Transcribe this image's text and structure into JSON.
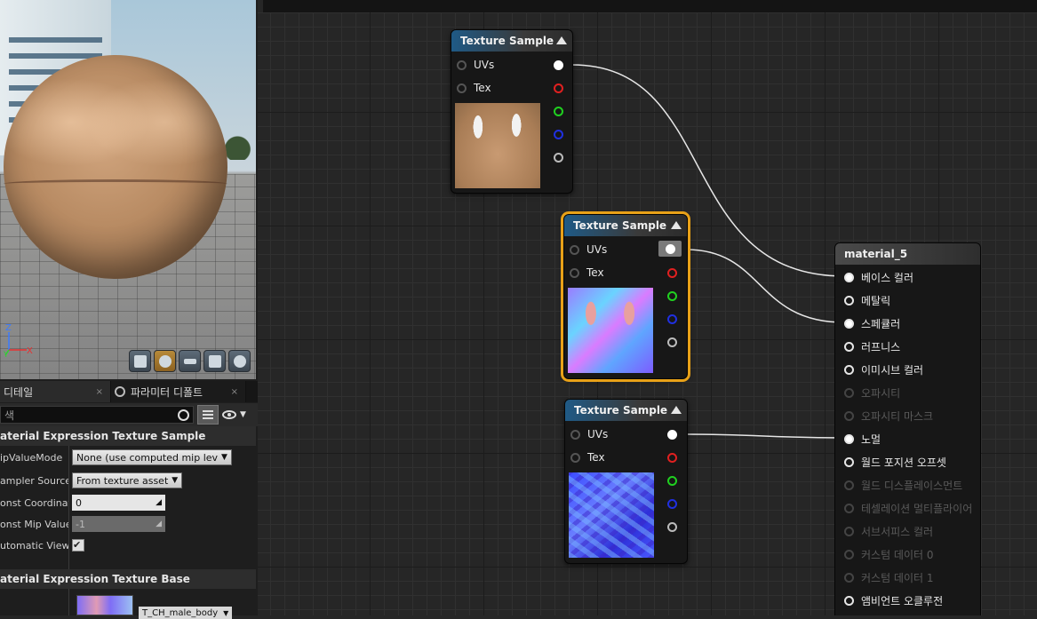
{
  "details_panel": {
    "tabs": [
      {
        "label": "디테일",
        "close": "×"
      },
      {
        "label": "파라미터 디폴트",
        "close": "×"
      }
    ],
    "search_placeholder": "색",
    "sections": {
      "texture_sample": {
        "title": "aterial Expression Texture Sample",
        "props": [
          {
            "name": "ipValueMode",
            "value": "None (use computed mip lev",
            "kind": "combo"
          },
          {
            "name": "ampler Source",
            "value": "From texture asset",
            "kind": "combo"
          },
          {
            "name": "onst Coordinate",
            "value": "0",
            "kind": "num"
          },
          {
            "name": "onst Mip Value",
            "value": "-1",
            "kind": "num-disabled"
          },
          {
            "name": "utomatic View M",
            "value": "✔",
            "kind": "check"
          }
        ]
      },
      "texture_base": {
        "title": "aterial Expression Texture Base",
        "texture_name": "T_CH_male_body"
      }
    }
  },
  "viewport": {
    "axis": {
      "z": "Z",
      "x": "X",
      "y": "Y"
    },
    "toolbar": [
      "cylinder",
      "sphere",
      "plane",
      "cube",
      "custom"
    ]
  },
  "graph": {
    "nodes": [
      {
        "id": "texture-sample-1",
        "title": "Texture Sample",
        "inputs": [
          "UVs",
          "Tex"
        ]
      },
      {
        "id": "texture-sample-2",
        "title": "Texture Sample",
        "inputs": [
          "UVs",
          "Tex"
        ]
      },
      {
        "id": "texture-sample-3",
        "title": "Texture Sample",
        "inputs": [
          "UVs",
          "Tex"
        ]
      }
    ],
    "result": {
      "title": "material_5",
      "inputs": [
        {
          "label": "베이스 컬러",
          "enabled": true,
          "connected": true
        },
        {
          "label": "메탈릭",
          "enabled": true,
          "connected": false
        },
        {
          "label": "스페큘러",
          "enabled": true,
          "connected": true
        },
        {
          "label": "러프니스",
          "enabled": true,
          "connected": false
        },
        {
          "label": "이미시브 컬러",
          "enabled": true,
          "connected": false
        },
        {
          "label": "오파시티",
          "enabled": false,
          "connected": false
        },
        {
          "label": "오파시티 마스크",
          "enabled": false,
          "connected": false
        },
        {
          "label": "노멀",
          "enabled": true,
          "connected": true
        },
        {
          "label": "월드 포지션 오프셋",
          "enabled": true,
          "connected": false
        },
        {
          "label": "월드 디스플레이스먼트",
          "enabled": false,
          "connected": false
        },
        {
          "label": "테셀레이션 멀티플라이어",
          "enabled": false,
          "connected": false
        },
        {
          "label": "서브서피스 컬러",
          "enabled": false,
          "connected": false
        },
        {
          "label": "커스텀 데이터 0",
          "enabled": false,
          "connected": false
        },
        {
          "label": "커스텀 데이터 1",
          "enabled": false,
          "connected": false
        },
        {
          "label": "앰비언트 오클루전",
          "enabled": true,
          "connected": false
        }
      ]
    }
  },
  "colors": {
    "selection": "#e8a118",
    "node_header": "#1f5a86",
    "pin_red": "#e02020",
    "pin_green": "#20d020",
    "pin_blue": "#2030e0"
  }
}
